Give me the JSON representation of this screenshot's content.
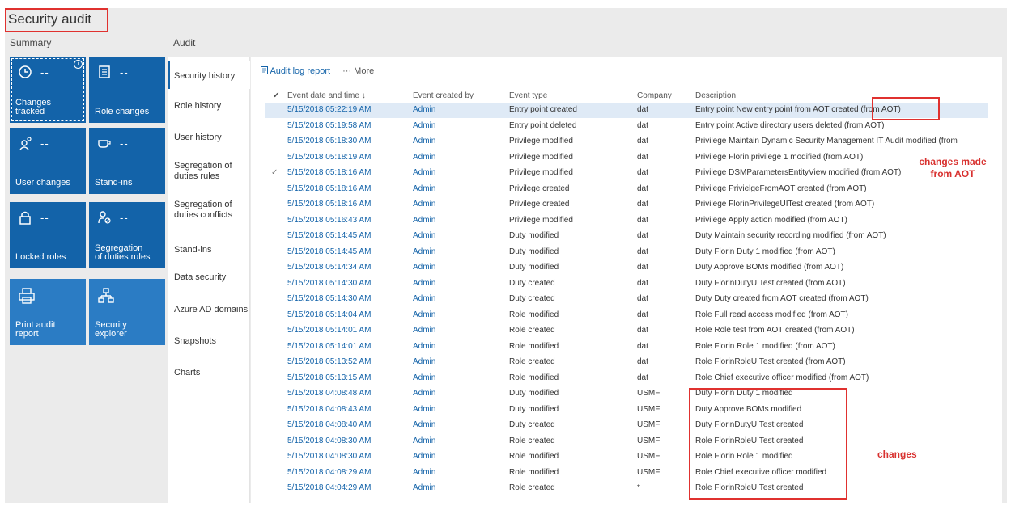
{
  "page": {
    "title": "Security audit",
    "summary_label": "Summary",
    "audit_label": "Audit"
  },
  "tiles": [
    {
      "label": "Changes tracked",
      "value": "--",
      "icon": "clock-icon"
    },
    {
      "label": "Role changes",
      "value": "--",
      "icon": "list-icon"
    },
    {
      "label": "User changes",
      "value": "--",
      "icon": "user-icon"
    },
    {
      "label": "Stand-ins",
      "value": "--",
      "icon": "cup-icon"
    },
    {
      "label": "Locked roles",
      "value": "--",
      "icon": "lock-icon"
    },
    {
      "label": "Segregation of duties rules",
      "value": "--",
      "icon": "people-icon"
    },
    {
      "label": "Print audit report",
      "value": "",
      "icon": "printer-icon"
    },
    {
      "label": "Security explorer",
      "value": "",
      "icon": "hierarchy-icon"
    }
  ],
  "info_icon": "i",
  "nav": [
    "Security history",
    "Role history",
    "User history",
    "Segregation of duties rules",
    "Segregation of duties conflicts",
    "Stand-ins",
    "Data security",
    "Azure AD domains",
    "Snapshots",
    "Charts"
  ],
  "toolbar": {
    "audit_log_report": "Audit log report",
    "more": "··· More"
  },
  "columns": {
    "date": "Event date and time ↓",
    "created_by": "Event created by",
    "type": "Event type",
    "company": "Company",
    "description": "Description"
  },
  "rows": [
    {
      "date": "5/15/2018 05:22:19 AM",
      "by": "Admin",
      "type": "Entry point created",
      "company": "dat",
      "desc": "Entry point New entry point from AOT created (from AOT)"
    },
    {
      "date": "5/15/2018 05:19:58 AM",
      "by": "Admin",
      "type": "Entry point deleted",
      "company": "dat",
      "desc": "Entry point Active directory users deleted (from AOT)"
    },
    {
      "date": "5/15/2018 05:18:30 AM",
      "by": "Admin",
      "type": "Privilege modified",
      "company": "dat",
      "desc": "Privilege Maintain Dynamic Security Management IT Audit modified (from"
    },
    {
      "date": "5/15/2018 05:18:19 AM",
      "by": "Admin",
      "type": "Privilege modified",
      "company": "dat",
      "desc": "Privilege Florin privilege 1 modified (from AOT)"
    },
    {
      "date": "5/15/2018 05:18:16 AM",
      "by": "Admin",
      "type": "Privilege modified",
      "company": "dat",
      "desc": "Privilege DSMParametersEntityView modified (from AOT)"
    },
    {
      "date": "5/15/2018 05:18:16 AM",
      "by": "Admin",
      "type": "Privilege created",
      "company": "dat",
      "desc": "Privilege PrivielgeFromAOT created (from AOT)"
    },
    {
      "date": "5/15/2018 05:18:16 AM",
      "by": "Admin",
      "type": "Privilege created",
      "company": "dat",
      "desc": "Privilege FlorinPrivilegeUITest created (from AOT)"
    },
    {
      "date": "5/15/2018 05:16:43 AM",
      "by": "Admin",
      "type": "Privilege modified",
      "company": "dat",
      "desc": "Privilege Apply action modified (from AOT)"
    },
    {
      "date": "5/15/2018 05:14:45 AM",
      "by": "Admin",
      "type": "Duty modified",
      "company": "dat",
      "desc": "Duty Maintain security recording modified (from AOT)"
    },
    {
      "date": "5/15/2018 05:14:45 AM",
      "by": "Admin",
      "type": "Duty modified",
      "company": "dat",
      "desc": "Duty Florin Duty 1 modified (from AOT)"
    },
    {
      "date": "5/15/2018 05:14:34 AM",
      "by": "Admin",
      "type": "Duty modified",
      "company": "dat",
      "desc": "Duty Approve BOMs modified (from AOT)"
    },
    {
      "date": "5/15/2018 05:14:30 AM",
      "by": "Admin",
      "type": "Duty created",
      "company": "dat",
      "desc": "Duty FlorinDutyUITest created (from AOT)"
    },
    {
      "date": "5/15/2018 05:14:30 AM",
      "by": "Admin",
      "type": "Duty created",
      "company": "dat",
      "desc": "Duty Duty created from AOT created (from AOT)"
    },
    {
      "date": "5/15/2018 05:14:04 AM",
      "by": "Admin",
      "type": "Role modified",
      "company": "dat",
      "desc": "Role Full read access modified (from AOT)"
    },
    {
      "date": "5/15/2018 05:14:01 AM",
      "by": "Admin",
      "type": "Role created",
      "company": "dat",
      "desc": "Role Role test from AOT created (from AOT)"
    },
    {
      "date": "5/15/2018 05:14:01 AM",
      "by": "Admin",
      "type": "Role modified",
      "company": "dat",
      "desc": "Role Florin Role 1 modified (from AOT)"
    },
    {
      "date": "5/15/2018 05:13:52 AM",
      "by": "Admin",
      "type": "Role created",
      "company": "dat",
      "desc": "Role FlorinRoleUITest created (from AOT)"
    },
    {
      "date": "5/15/2018 05:13:15 AM",
      "by": "Admin",
      "type": "Role modified",
      "company": "dat",
      "desc": "Role Chief executive officer modified (from AOT)"
    },
    {
      "date": "5/15/2018 04:08:48 AM",
      "by": "Admin",
      "type": "Duty modified",
      "company": "USMF",
      "desc": "Duty Florin Duty 1 modified"
    },
    {
      "date": "5/15/2018 04:08:43 AM",
      "by": "Admin",
      "type": "Duty modified",
      "company": "USMF",
      "desc": "Duty Approve BOMs modified"
    },
    {
      "date": "5/15/2018 04:08:40 AM",
      "by": "Admin",
      "type": "Duty created",
      "company": "USMF",
      "desc": "Duty FlorinDutyUITest created"
    },
    {
      "date": "5/15/2018 04:08:30 AM",
      "by": "Admin",
      "type": "Role created",
      "company": "USMF",
      "desc": "Role FlorinRoleUITest created"
    },
    {
      "date": "5/15/2018 04:08:30 AM",
      "by": "Admin",
      "type": "Role modified",
      "company": "USMF",
      "desc": "Role Florin Role 1 modified"
    },
    {
      "date": "5/15/2018 04:08:29 AM",
      "by": "Admin",
      "type": "Role modified",
      "company": "USMF",
      "desc": "Role Chief executive officer modified"
    },
    {
      "date": "5/15/2018 04:04:29 AM",
      "by": "Admin",
      "type": "Role created",
      "company": "*",
      "desc": "Role FlorinRoleUITest created"
    }
  ],
  "annotations": {
    "aot": "changes made from AOT",
    "changes": "changes"
  },
  "colors": {
    "tile_dark": "#1363a9",
    "tile_light": "#2b7cc4",
    "link_blue": "#1363a9",
    "annotation_red": "#e0312f",
    "selected_row": "#dfeaf6"
  }
}
